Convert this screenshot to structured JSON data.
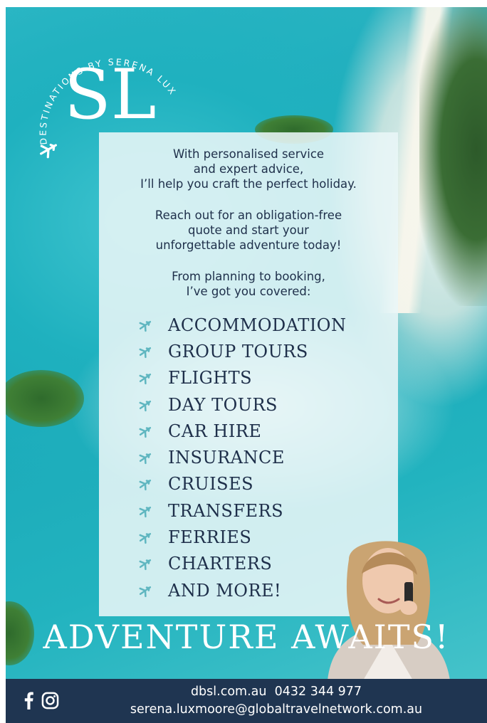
{
  "logo": {
    "arc_text": "DESTINATIONS BY SERENA LUXMOORE",
    "monogram": "SL",
    "icon": "airplane-icon"
  },
  "intro": {
    "p1": [
      "With personalised service",
      "and expert advice,",
      "I’ll help you craft the perfect holiday."
    ],
    "p2": [
      "Reach out for an obligation-free",
      "quote and start your",
      "unforgettable adventure today!"
    ],
    "p3": [
      "From planning to booking,",
      "I’ve got you covered:"
    ]
  },
  "services": {
    "icon": "airplane-icon",
    "items": [
      "ACCOMMODATION",
      "GROUP TOURS",
      "FLIGHTS",
      "DAY TOURS",
      "CAR HIRE",
      "INSURANCE",
      "CRUISES",
      "TRANSFERS",
      "FERRIES",
      "CHARTERS",
      "AND MORE!"
    ]
  },
  "headline": "ADVENTURE AWAITS!",
  "footer": {
    "website": "dbsl.com.au",
    "phone": "0432 344 977",
    "email": "serena.luxmoore@globaltravelnetwork.com.au",
    "icons": [
      "facebook-icon",
      "instagram-icon"
    ]
  },
  "colors": {
    "navy": "#1e2f4a",
    "footer_bg": "#1f3551",
    "turquoise": "#1fb1bf",
    "plane_icon": "#5fb6c0"
  }
}
